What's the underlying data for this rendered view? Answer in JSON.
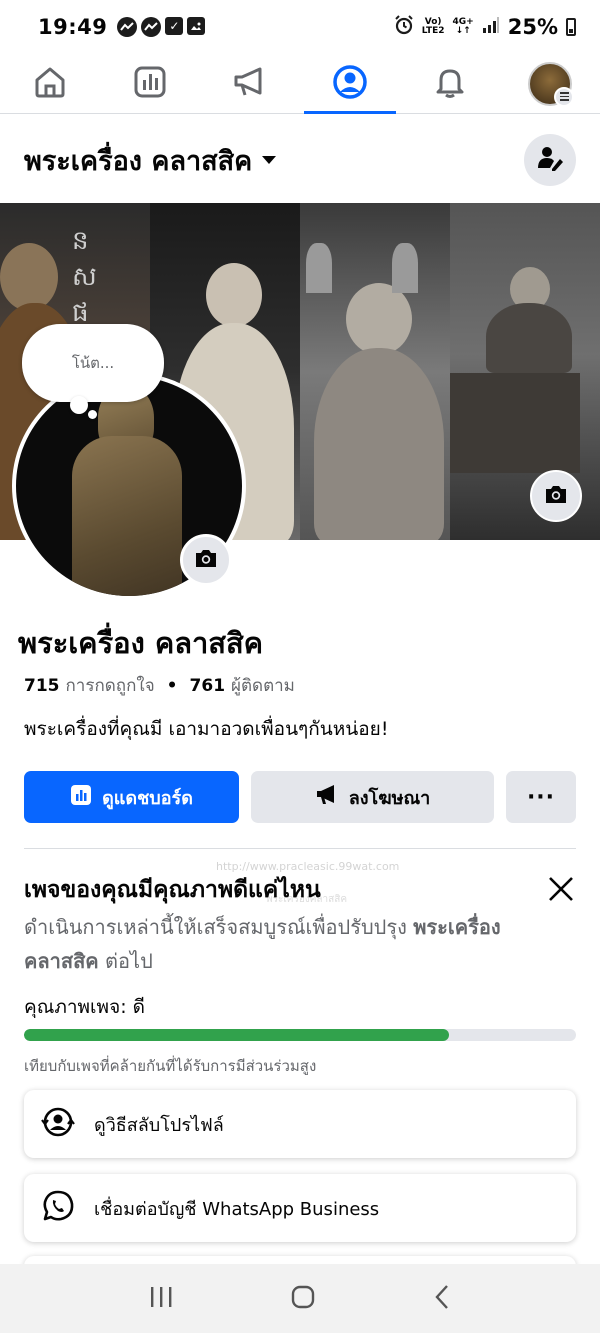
{
  "status_bar": {
    "time": "19:49",
    "network_top": "Vo)",
    "network_bottom": "LTE2",
    "network_type": "4G+",
    "battery": "25%"
  },
  "nav": {
    "icons": [
      "home-icon",
      "dashboard-icon",
      "megaphone-icon",
      "profile-icon",
      "bell-icon",
      "avatar"
    ],
    "active": "profile-icon"
  },
  "header": {
    "page_title": "พระเครื่อง คลาสสิค"
  },
  "note": {
    "placeholder": "โน้ต..."
  },
  "profile": {
    "name": "พระเครื่อง คลาสสิค",
    "likes_count": "715",
    "likes_label": "การกดถูกใจ",
    "followers_count": "761",
    "followers_label": "ผู้ติดตาม",
    "bio": "พระเครื่องที่คุณมี เอามาอวดเพื่อนๆกันหน่อย!"
  },
  "actions": {
    "dashboard_label": "ดูแดชบอร์ด",
    "advertise_label": "ลงโฆษณา",
    "more_label": "···"
  },
  "quality": {
    "watermark": "http://www.pracleasic.99wat.com",
    "watermark2": "พระเครื่องคลาสสิค",
    "title": "เพจของคุณมีคุณภาพดีแค่ไหน",
    "desc_prefix": "ดำเนินการเหล่านี้ให้เสร็จสมบูรณ์เพื่อปรับปรุง ",
    "desc_page": "พระเครื่อง คลาสสิค",
    "desc_suffix": " ต่อไป",
    "quality_text": "คุณภาพเพจ: ดี",
    "progress": 0.77,
    "compare_text": "เทียบกับเพจที่คล้ายกันที่ได้รับการมีส่วนร่วมสูง",
    "tasks": [
      {
        "label": "ดูวิธีสลับโปรไฟล์",
        "icon": "switch-profile-icon"
      },
      {
        "label": "เชื่อมต่อบัญชี WhatsApp Business",
        "icon": "whatsapp-icon"
      }
    ]
  },
  "colors": {
    "accent": "#0866ff",
    "progress": "#31a24c",
    "button_gray": "#e4e6eb"
  }
}
